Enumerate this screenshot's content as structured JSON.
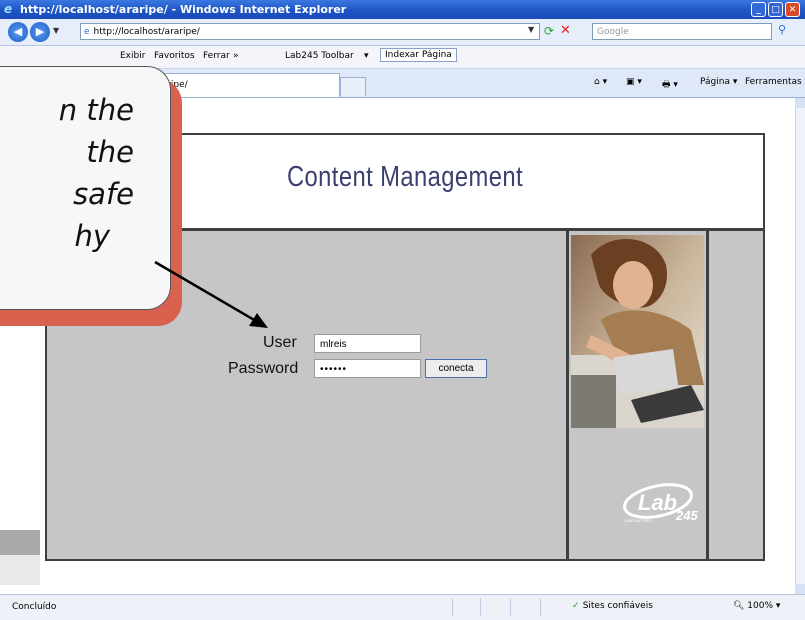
{
  "window": {
    "title": "http://localhost/araripe/ - Windows Internet Explorer",
    "minimize": "_",
    "maximize": "□",
    "close": "✕"
  },
  "address_bar": {
    "url": "http://localhost/araripe/",
    "search_placeholder": "Google"
  },
  "menu": {
    "items": [
      "Exibir",
      "Favoritos",
      "Ferrar",
      "»"
    ],
    "toolbar_name": "Lab245 Toolbar",
    "toolbar_drop": "▾",
    "indexar": "Indexar Página"
  },
  "tabs": {
    "active_title": "calhost/araripe/"
  },
  "command_bar": {
    "home": "⌂ ▾",
    "feeds": "▣ ▾",
    "print": "🖶 ▾",
    "page": "Página ▾",
    "tools": "Ferramentas ▾"
  },
  "page": {
    "title": "Content Management",
    "user_label": "User",
    "user_value": "mlreis",
    "password_label": "Password",
    "password_value": "••••••",
    "connect_button": "conecta",
    "logo_text": "Lab",
    "logo_number": "245",
    "logo_subtext": "LABORATÓRIO"
  },
  "status": {
    "text": "Concluído",
    "zone": "Sites confiáveis",
    "zoom": "100%"
  },
  "callout": {
    "lines": [
      "n the",
      "the",
      "safe",
      "hy"
    ]
  },
  "colors": {
    "title_blue": "#3c3f70",
    "callout_shadow": "#d9624f",
    "panel_gray": "#c6c6c6"
  }
}
